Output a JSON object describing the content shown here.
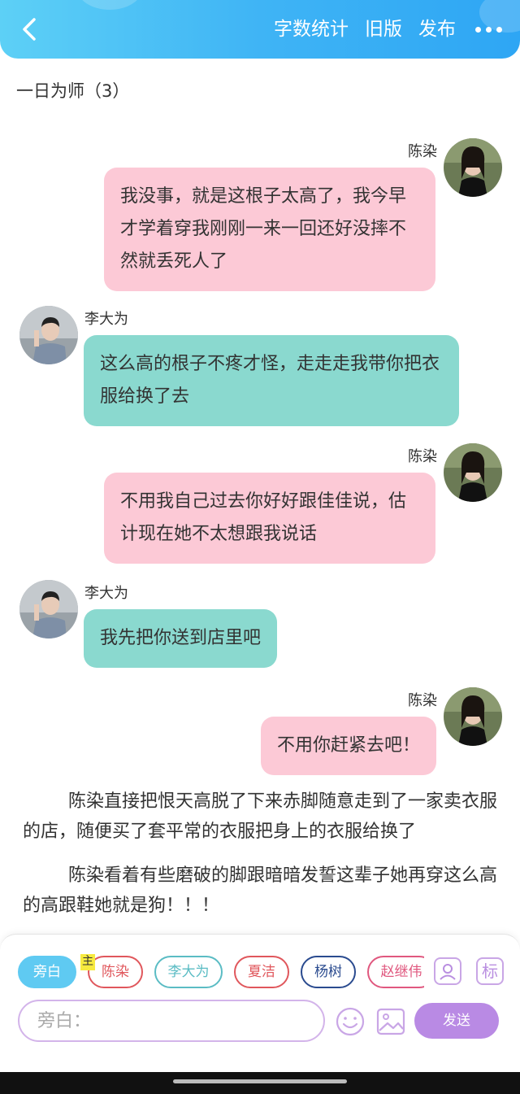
{
  "header": {
    "back_icon": "chevron-left-icon",
    "actions": [
      "字数统计",
      "旧版",
      "发布"
    ],
    "more_icon": "more-dots-icon",
    "colors": {
      "gradient_start": "#5dd0f6",
      "gradient_end": "#2ea6f4"
    }
  },
  "chapter_title": "一日为师（3）",
  "messages": [
    {
      "speaker": "陈染",
      "side": "right",
      "text": "我没事，就是这根子太高了，我今早才学着穿我刚刚一来一回还好没摔不然就丢死人了"
    },
    {
      "speaker": "李大为",
      "side": "left",
      "text": "这么高的根子不疼才怪，走走走我带你把衣服给换了去"
    },
    {
      "speaker": "陈染",
      "side": "right",
      "text": "不用我自己过去你好好跟佳佳说，估计现在她不太想跟我说话"
    },
    {
      "speaker": "李大为",
      "side": "left",
      "text": "我先把你送到店里吧"
    },
    {
      "speaker": "陈染",
      "side": "right",
      "text": "不用你赶紧去吧！"
    }
  ],
  "narration": [
    "陈染直接把恨天高脱了下来赤脚随意走到了一家卖衣服的店，随便买了套平常的衣服把身上的衣服给换了",
    "陈染看着有些磨破的脚跟暗暗发誓这辈子她再穿这么高的高跟鞋她就是狗！！！"
  ],
  "composer": {
    "roles": [
      {
        "label": "旁白",
        "color": "#5fcaf2",
        "active": true
      },
      {
        "label": "陈染",
        "color": "#e0575c",
        "active": false
      },
      {
        "label": "李大为",
        "color": "#5bbcc4",
        "active": false
      },
      {
        "label": "夏洁",
        "color": "#e0575c",
        "active": false
      },
      {
        "label": "杨树",
        "color": "#2a4b8f",
        "active": false
      },
      {
        "label": "赵继伟",
        "color": "#e0587f",
        "active": false
      }
    ],
    "main_badge": "主",
    "side_icons": [
      "person-card-icon",
      "标"
    ],
    "input_placeholder": "旁白：",
    "emoji_icon": "smiley-icon",
    "image_icon": "image-icon",
    "send_label": "发送",
    "accent": "#b98ae4"
  },
  "colors": {
    "pink_bubble": "#fcc9d6",
    "teal_bubble": "#8ad9cf"
  }
}
